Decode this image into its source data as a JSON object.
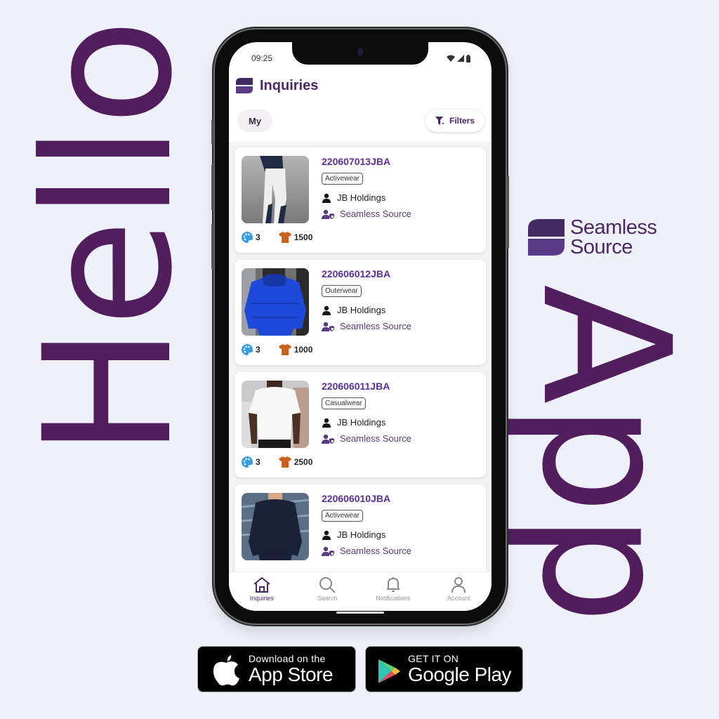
{
  "poster": {
    "left_word": "Hello",
    "right_word": "App",
    "brand": {
      "name_line1": "Seamless",
      "name_line2": "Source",
      "logo_icon": "seamless-source-logo"
    },
    "colors": {
      "background": "#eef0fa",
      "primary": "#521d5c",
      "accent": "#5a2f9a"
    }
  },
  "phone": {
    "status_bar": {
      "time": "09:25",
      "icons": [
        "wifi-icon",
        "signal-icon",
        "battery-icon"
      ]
    },
    "header": {
      "title": "Inquiries"
    },
    "toolbar": {
      "my_label": "My",
      "filters_label": "Filters"
    },
    "inquiries": [
      {
        "id": "220607013JBA",
        "category": "Activewear",
        "owner": "JB Holdings",
        "source": "Seamless Source",
        "colors_count": "3",
        "quantity": "1500",
        "image": "white-leggings"
      },
      {
        "id": "220606012JBA",
        "category": "Outerwear",
        "owner": "JB Holdings",
        "source": "Seamless Source",
        "colors_count": "3",
        "quantity": "1000",
        "image": "blue-puffer-jacket"
      },
      {
        "id": "220606011JBA",
        "category": "Casualwear",
        "owner": "JB Holdings",
        "source": "Seamless Source",
        "colors_count": "3",
        "quantity": "2500",
        "image": "white-tshirt"
      },
      {
        "id": "220606010JBA",
        "category": "Activewear",
        "owner": "JB Holdings",
        "source": "Seamless Source",
        "image": "navy-compression-shirt"
      }
    ],
    "tabs": [
      {
        "label": "Inquiries",
        "icon": "home-icon",
        "active": true
      },
      {
        "label": "Search",
        "icon": "search-icon",
        "active": false
      },
      {
        "label": "Notifications",
        "icon": "bell-icon",
        "active": false
      },
      {
        "label": "Account",
        "icon": "user-icon",
        "active": false
      }
    ]
  },
  "stores": {
    "apple": {
      "small": "Download on the",
      "big": "App Store"
    },
    "google": {
      "small": "GET IT ON",
      "big": "Google Play"
    }
  }
}
